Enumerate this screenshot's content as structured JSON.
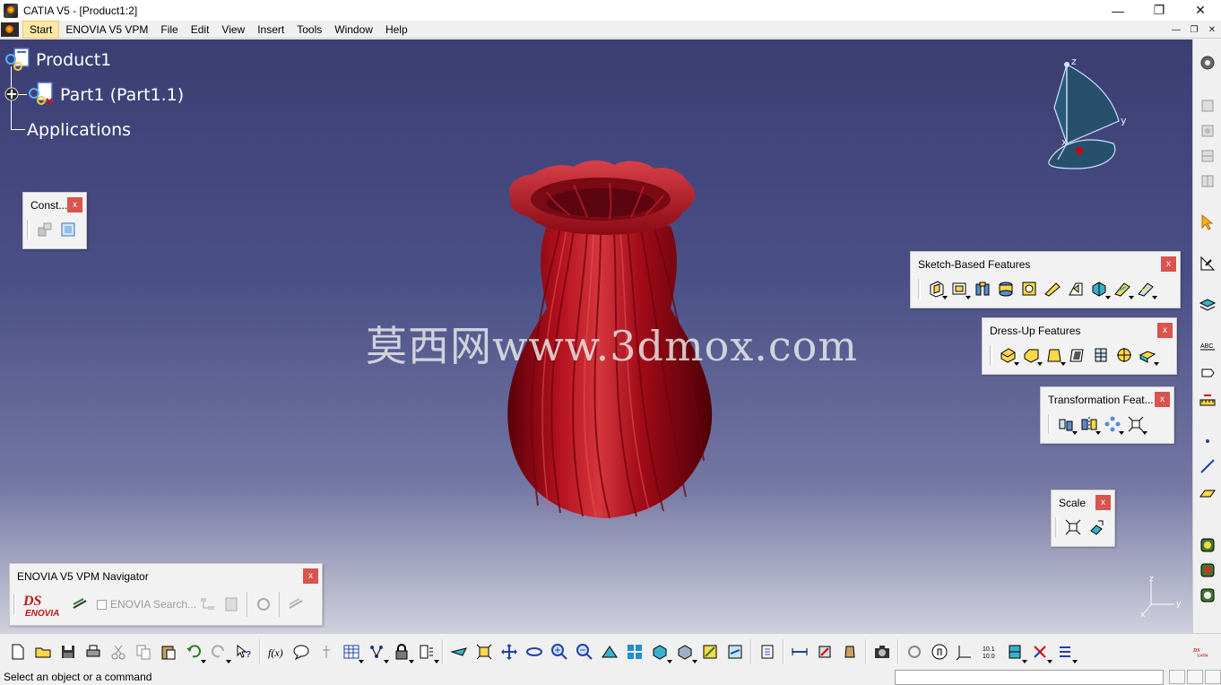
{
  "window": {
    "title": "CATIA V5 - [Product1:2]"
  },
  "menu": {
    "items": [
      "Start",
      "ENOVIA V5 VPM",
      "File",
      "Edit",
      "View",
      "Insert",
      "Tools",
      "Window",
      "Help"
    ]
  },
  "tree": {
    "root": "Product1",
    "child": "Part1 (Part1.1)",
    "applications": "Applications"
  },
  "watermark": "莫西网www.3dmox.com",
  "compass": {
    "x": "x",
    "y": "y",
    "z": "z"
  },
  "toolbars": {
    "constraints": {
      "title": "Const..."
    },
    "sketch_based": {
      "title": "Sketch-Based Features"
    },
    "dress_up": {
      "title": "Dress-Up Features"
    },
    "transformation": {
      "title": "Transformation Feat..."
    },
    "scale": {
      "title": "Scale"
    },
    "enovia_nav": {
      "title": "ENOVIA V5 VPM Navigator",
      "search_placeholder": "ENOVIA Search...",
      "logo_text": "ENOVIA"
    }
  },
  "close_label": "x",
  "status": {
    "text": "Select an object or a command"
  },
  "colors": {
    "viewport_top": "#3b3e73",
    "vase": "#b0101e",
    "accent_close": "#d9534f"
  }
}
